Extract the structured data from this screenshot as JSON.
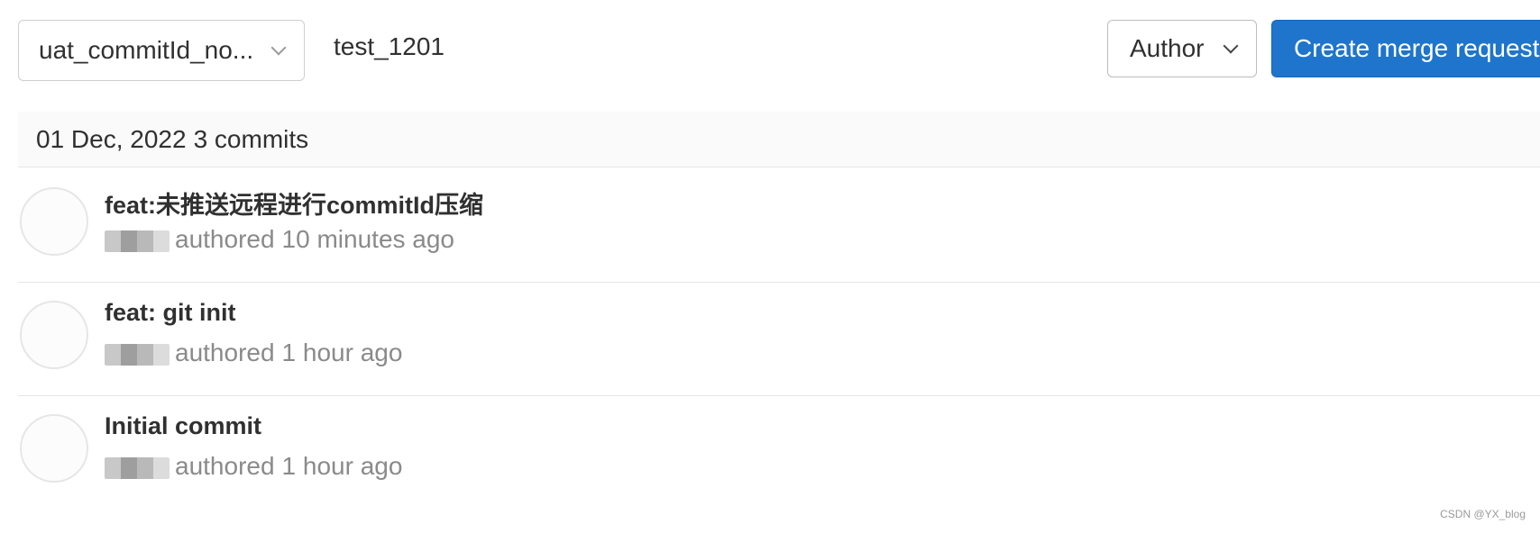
{
  "toolbar": {
    "branch_select_label": "uat_commitId_no...",
    "branch_path": "test_1201",
    "author_label": "Author",
    "create_mr_label": "Create merge request"
  },
  "day_group": {
    "date": "01 Dec, 2022",
    "commit_count": "3 commits"
  },
  "commits": [
    {
      "title": "feat:未推送远程进行commitId压缩",
      "action": "authored",
      "time": "10 minutes ago"
    },
    {
      "title": "feat: git init",
      "action": "authored",
      "time": "1 hour ago"
    },
    {
      "title": "Initial commit",
      "action": "authored",
      "time": "1 hour ago"
    }
  ],
  "watermark": "CSDN @YX_blog",
  "colors": {
    "primary": "#1f75cb",
    "border": "#e5e5e5",
    "muted_text": "#8a8a8a",
    "header_bg": "#fafafa"
  },
  "icons": {
    "branch_dropdown": "chevron-down-icon",
    "author_dropdown": "chevron-down-icon"
  }
}
